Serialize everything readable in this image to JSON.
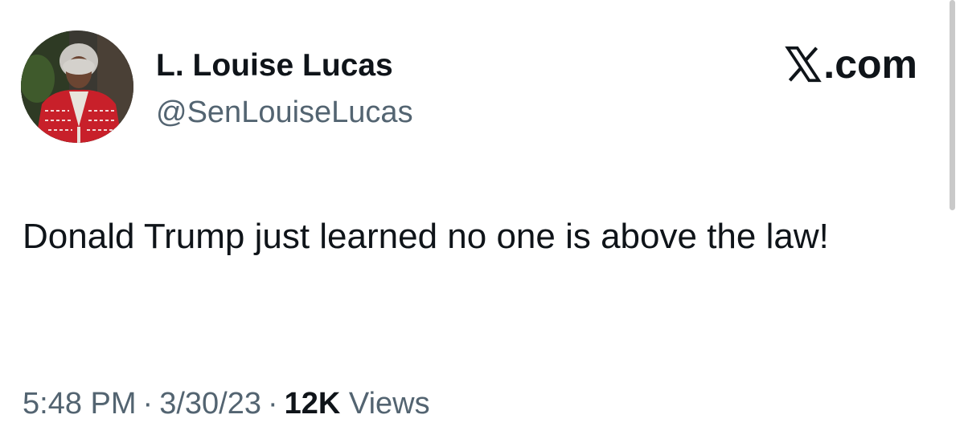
{
  "author": {
    "name": "L. Louise Lucas",
    "handle": "@SenLouiseLucas"
  },
  "brand": {
    "suffix": ".com",
    "icon": "x-logo-icon"
  },
  "tweet": {
    "text": "Donald Trump just learned no one is above the law!"
  },
  "meta": {
    "time": "5:48 PM",
    "separator": "·",
    "date": "3/30/23",
    "views_count": "12K",
    "views_label": "Views"
  },
  "colors": {
    "text_primary": "#0f1419",
    "text_secondary": "#536471",
    "jacket_red": "#c8202a"
  }
}
